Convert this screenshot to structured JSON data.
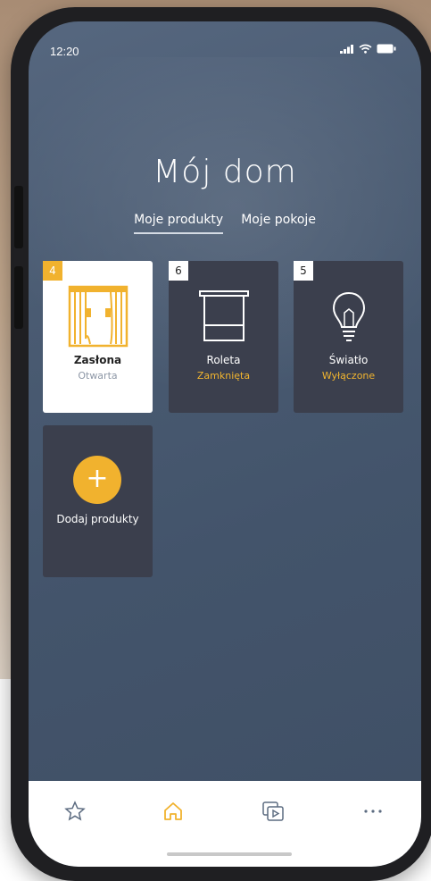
{
  "status_bar": {
    "time": "12:20"
  },
  "header": {
    "title": "Mój dom"
  },
  "tabs": [
    {
      "label": "Moje produkty",
      "active": true
    },
    {
      "label": "Moje pokoje",
      "active": false
    }
  ],
  "products": [
    {
      "count": "4",
      "name": "Zasłona",
      "state": "Otwarta",
      "icon": "curtain-icon",
      "selected": true
    },
    {
      "count": "6",
      "name": "Roleta",
      "state": "Zamknięta",
      "icon": "roller-blind-icon",
      "selected": false
    },
    {
      "count": "5",
      "name": "Światło",
      "state": "Wyłączone",
      "icon": "lightbulb-icon",
      "selected": false
    }
  ],
  "add_product": {
    "icon": "plus-icon",
    "label": "Dodaj produkty"
  },
  "bottom_nav": [
    {
      "icon": "star-icon"
    },
    {
      "icon": "home-icon",
      "active": true
    },
    {
      "icon": "scenes-icon"
    },
    {
      "icon": "more-icon"
    }
  ],
  "colors": {
    "accent": "#f1b22e",
    "screen_bg": "#4a5b72",
    "tile_dark": "#3b3f4d"
  }
}
